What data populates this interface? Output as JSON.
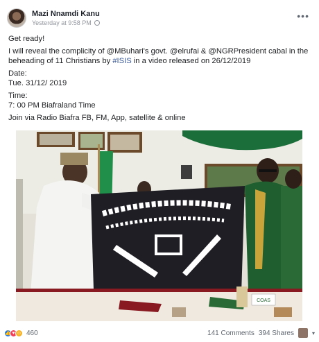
{
  "post": {
    "author": "Mazi Nnamdi Kanu",
    "timestamp": "Yesterday at 9:58 PM",
    "privacy_icon": "globe-icon",
    "more_label": "•••"
  },
  "body": {
    "line1": "Get ready!",
    "line2_pre": "I will reveal the complicity of @MBuhari's govt. @elrufai & @NGRPresident cabal in the beheading of 11 Christians by ",
    "hashtag": "#ISIS",
    "line2_post": " in a video released on 26/12/2019",
    "date_label": "Date:",
    "date_value": "Tue. 31/12/ 2019",
    "time_label": "Time:",
    "time_value": "7: 00 PM Biafraland Time",
    "join": "Join via Radio Biafra FB, FM, App, satellite & online"
  },
  "photo": {
    "banner_text": "جماعة أهل السنة للدعوة والجهاد",
    "cup_label": "COAS"
  },
  "footer": {
    "reaction_count": "460",
    "comments": "141 Comments",
    "shares": "394 Shares"
  },
  "colors": {
    "link": "#385898",
    "flag_green": "#1f8f4a",
    "banner": "#1e1e24"
  }
}
